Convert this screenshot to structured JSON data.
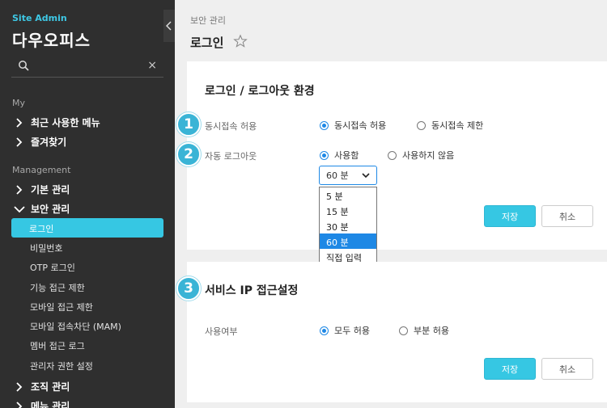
{
  "sidebar": {
    "site_admin": "Site Admin",
    "brand": "다우오피스",
    "search": {
      "value": "",
      "clear": "×"
    },
    "sections": {
      "my": "My",
      "management": "Management"
    },
    "my_items": [
      "최근 사용한 메뉴",
      "즐겨찾기"
    ],
    "mgmt_items": [
      "기본 관리",
      "보안 관리",
      "조직 관리",
      "메뉴 관리"
    ],
    "security_sub": [
      "로그인",
      "비밀번호",
      "OTP 로그인",
      "기능 접근 제한",
      "모바일 접근 제한",
      "모바일 접속차단 (MAM)",
      "멤버 접근 로그",
      "관리자 권한 설정"
    ]
  },
  "main": {
    "breadcrumb": "보안 관리",
    "title": "로그인",
    "card1": {
      "title": "로그인 / 로그아웃 환경",
      "rows": [
        {
          "badge": "1",
          "label": "동시접속 허용",
          "options": [
            "동시접속 허용",
            "동시접속 제한"
          ],
          "selected": 0
        },
        {
          "badge": "2",
          "label": "자동 로그아웃",
          "options": [
            "사용함",
            "사용하지 않음"
          ],
          "selected": 0
        }
      ],
      "select": {
        "value": "60 분",
        "options": [
          "5 분",
          "15 분",
          "30 분",
          "60 분",
          "직접 입력"
        ],
        "selected": 3
      },
      "save": "저장",
      "cancel": "취소"
    },
    "card2": {
      "badge": "3",
      "title": "서비스 IP 접근설정",
      "row": {
        "label": "사용여부",
        "options": [
          "모두 허용",
          "부분 허용"
        ],
        "selected": 0
      },
      "save": "저장",
      "cancel": "취소"
    }
  },
  "colors": {
    "accent": "#36c7e3",
    "badge": "#3ab4d6",
    "radio": "#1e88e5",
    "sidebar": "#2f2f2f"
  }
}
